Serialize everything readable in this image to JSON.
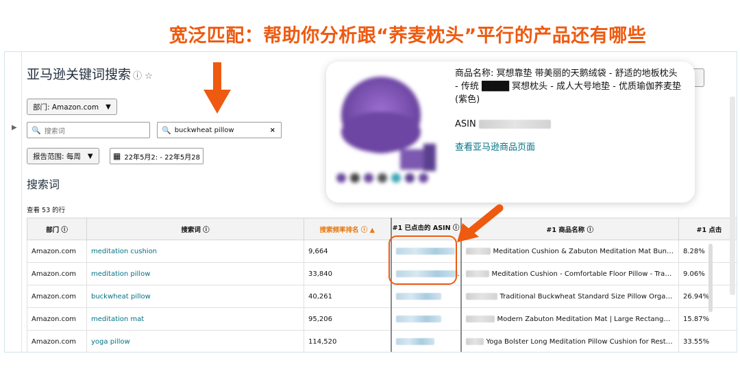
{
  "banner": "宽泛匹配：帮助你分析跟“荞麦枕头”平行的产品还有哪些",
  "page": {
    "title": "亚马逊关键词搜索",
    "title_icons": "ⓘ ☆",
    "department_dropdown": "部门: Amazon.com",
    "search_placeholder": "搜索词",
    "search_value": "buckwheat pillow",
    "report_range": "报告范围: 每周",
    "date_range": "22年5月2: - 22年5月28",
    "section_title": "搜索词",
    "row_count": "查看 53 的行"
  },
  "table": {
    "columns": [
      "部门 ⓘ",
      "搜索词 ⓘ",
      "搜索频率排名 ⓘ ▲",
      "#1 已点击的 ASIN ⓘ",
      "#1 商品名称 ⓘ",
      "#1 点击"
    ],
    "rows": [
      {
        "dept": "Amazon.com",
        "term": "meditation cushion",
        "rank": "9,664",
        "product": "Meditation Cushion & Zabuton Meditation Mat Bundle...",
        "share": "8.28%"
      },
      {
        "dept": "Amazon.com",
        "term": "meditation pillow",
        "rank": "33,840",
        "product": "Meditation Cushion - Comfortable Floor Pillow - Tradit...",
        "share": "9.06%"
      },
      {
        "dept": "Amazon.com",
        "term": "buckwheat pillow",
        "rank": "40,261",
        "product": "Traditional Buckwheat Standard Size Pillow Organic...",
        "share": "26.94%"
      },
      {
        "dept": "Amazon.com",
        "term": "meditation mat",
        "rank": "95,206",
        "product": "Modern Zabuton Meditation Mat | Large Rectangula...",
        "share": "15.87%"
      },
      {
        "dept": "Amazon.com",
        "term": "yoga pillow",
        "rank": "114,520",
        "product": "Yoga Bolster Long Meditation Pillow Cushion for Restor...",
        "share": "33.55%"
      }
    ]
  },
  "popup": {
    "product_name": "商品名称: 冥想靠垫 带美丽的天鹅绒袋 - 舒适的地板枕头 - 传统 ████ 冥想枕头 - 成人大号地垫 - 优质瑜伽荞麦垫(紫色)",
    "asin_label": "ASIN",
    "view_link": "查看亚马逊商品页面"
  },
  "colors": {
    "accent": "#ee5a10",
    "link": "#007185",
    "sorted": "#e47911"
  }
}
